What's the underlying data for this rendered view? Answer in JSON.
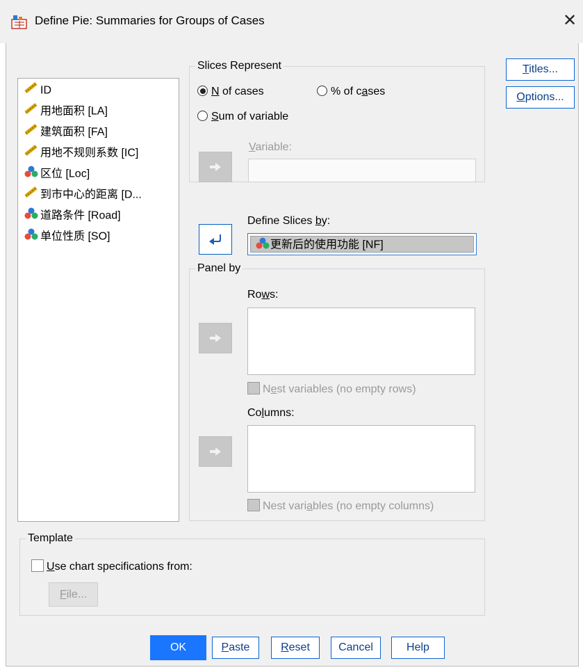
{
  "window": {
    "title": "Define Pie: Summaries for Groups of Cases",
    "close_glyph": "✕"
  },
  "variables": [
    {
      "label": "ID",
      "icon": "scale-ruler-icon"
    },
    {
      "label": "用地面积 [LA]",
      "icon": "scale-ruler-icon"
    },
    {
      "label": "建筑面积 [FA]",
      "icon": "scale-ruler-icon"
    },
    {
      "label": "用地不规则系数 [IC]",
      "icon": "scale-ruler-icon"
    },
    {
      "label": "区位 [Loc]",
      "icon": "nominal-balls-icon"
    },
    {
      "label": "到市中心的距离 [D...",
      "icon": "scale-ruler-icon"
    },
    {
      "label": "道路条件 [Road]",
      "icon": "nominal-balls-icon"
    },
    {
      "label": "单位性质 [SO]",
      "icon": "nominal-balls-icon"
    }
  ],
  "slices_represent": {
    "legend": "Slices Represent",
    "options": [
      {
        "pre": "",
        "key": "N",
        "post": " of cases",
        "selected": true
      },
      {
        "pre": "% of c",
        "key": "a",
        "post": "ses",
        "selected": false
      },
      {
        "pre": "",
        "key": "S",
        "post": "um of variable",
        "selected": false
      }
    ],
    "variable_label": {
      "pre": "",
      "key": "V",
      "post": "ariable:"
    },
    "variable_value": ""
  },
  "define_slices": {
    "label": {
      "pre": "Define Slices ",
      "key": "b",
      "post": "y:"
    },
    "value": "更新后的使用功能 [NF]"
  },
  "panel_by": {
    "legend": "Panel by",
    "rows_label": {
      "pre": "Ro",
      "key": "w",
      "post": "s:"
    },
    "rows_nest": {
      "pre": "N",
      "key": "e",
      "post": "st variables (no empty rows)"
    },
    "columns_label": {
      "pre": "Co",
      "key": "l",
      "post": "umns:"
    },
    "columns_nest": {
      "pre": "Nest vari",
      "key": "a",
      "post": "bles (no empty columns)"
    }
  },
  "template": {
    "legend": "Template",
    "use_spec": {
      "pre": "",
      "key": "U",
      "post": "se chart specifications from:"
    },
    "file_button": {
      "pre": "",
      "key": "F",
      "post": "ile..."
    }
  },
  "side_buttons": {
    "titles": {
      "pre": "",
      "key": "T",
      "post": "itles..."
    },
    "options": {
      "pre": "",
      "key": "O",
      "post": "ptions..."
    }
  },
  "bottom_buttons": {
    "ok": "OK",
    "paste": {
      "pre": "",
      "key": "P",
      "post": "aste"
    },
    "reset": {
      "pre": "",
      "key": "R",
      "post": "eset"
    },
    "cancel": "Cancel",
    "help": "Help"
  },
  "colors": {
    "accent": "#1a75ff",
    "link": "#0b3f8c"
  }
}
